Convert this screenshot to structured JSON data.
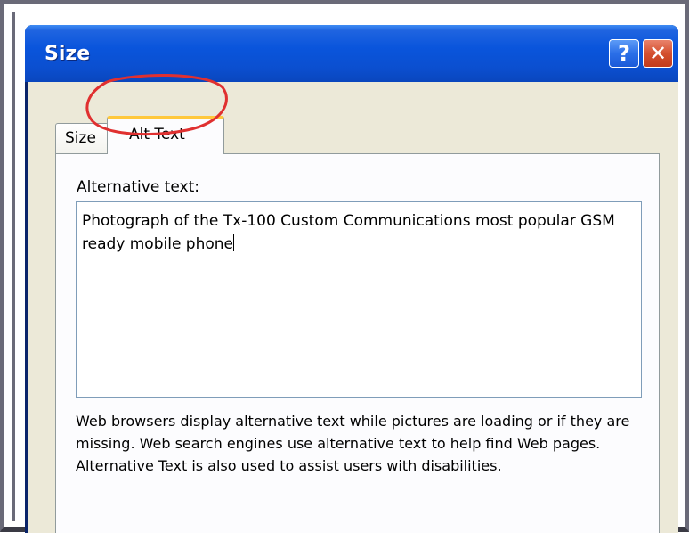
{
  "window": {
    "title": "Size",
    "help_button_glyph": "?",
    "close_button_glyph": "✕"
  },
  "tabs": [
    {
      "label": "Size",
      "active": false
    },
    {
      "label": "Alt Text",
      "active": true
    }
  ],
  "alt_text_field": {
    "label_accel": "A",
    "label_rest": "lternative text:",
    "value": "Photograph of the Tx-100 Custom Communications most popular GSM ready mobile phone"
  },
  "help_text": "Web browsers display alternative text while pictures are loading or if they are missing.  Web search engines use alternative text to help find Web pages.  Alternative Text is also used to assist users with disabilities.",
  "annotation": {
    "highlight_color": "#e03030",
    "highlights": "Alt Text tab"
  },
  "colors": {
    "titlebar": "#0a55dc",
    "client_bg": "#ece9d8",
    "tab_active_accent": "#ffc83c",
    "close_button": "#d4502f"
  }
}
